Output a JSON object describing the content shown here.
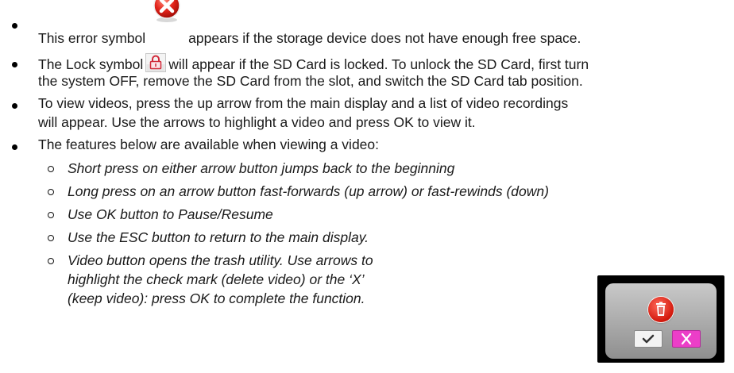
{
  "bullets": {
    "b1_pre": "This error symbol",
    "b1_post": "appears if the storage device does not have enough free space.",
    "b2_pre": "The Lock symbol",
    "b2_post": "will appear if the SD Card is locked. To unlock the SD Card, first turn",
    "b2_line2": "the system OFF, remove the SD Card from the slot, and switch the SD Card tab position.",
    "b3_line1": "To view videos, press the up arrow from the main display and a list of video recordings",
    "b3_line2": "will appear. Use the arrows to highlight a video and press OK to view it.",
    "b4": "The features below are available when viewing a video:"
  },
  "features": [
    "Short press on either arrow button jumps back to the beginning",
    "Long press on an arrow button fast-forwards (up arrow) or fast-rewinds (down)",
    "Use OK button to Pause/Resume",
    "Use the ESC button to return to the main display.",
    "Video button opens the trash utility. Use arrows to",
    "highlight the check mark (delete video) or the ‘X’",
    "(keep video): press OK to complete the function."
  ],
  "icons": {
    "error": "error-x-icon",
    "lock": "lock-icon",
    "trash": "trash-icon",
    "check": "check-icon",
    "close": "close-x-icon"
  },
  "colors": {
    "error_red": "#e2231a",
    "x_button_pink": "#ec3ec8"
  }
}
